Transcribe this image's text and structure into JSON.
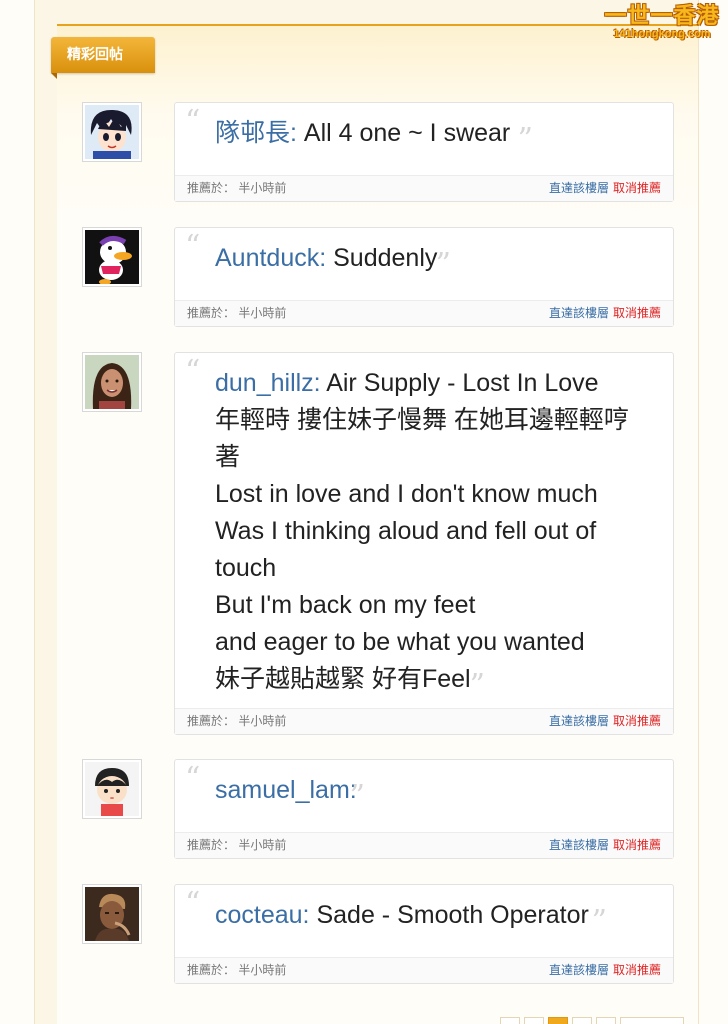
{
  "site_logo": {
    "main": "一世一香港",
    "sub": "141hongkong.com"
  },
  "section_title": "精彩回帖",
  "footer_labels": {
    "recommended": "推薦於：",
    "jump": "直達該樓層",
    "cancel": "取消推薦"
  },
  "posts": [
    {
      "author": "隊邨長:",
      "lines": [
        " All 4 one ~ I swear"
      ],
      "time": "半小時前",
      "avatar": "anime-boy"
    },
    {
      "author": "Auntduck:",
      "lines": [
        " Suddenly"
      ],
      "time": "半小時前",
      "avatar": "duck"
    },
    {
      "author": "dun_hillz:",
      "lines": [
        " Air Supply - Lost In Love",
        "年輕時 摟住妹子慢舞 在她耳邊輕輕哼",
        "著",
        "Lost in love and I don't know much",
        "Was I thinking aloud and fell out of",
        "touch",
        "But I'm back on my feet",
        "and eager to be what you wanted",
        "妹子越貼越緊 好有Feel"
      ],
      "time": "半小時前",
      "avatar": "woman"
    },
    {
      "author": "samuel_lam:",
      "lines": [
        ""
      ],
      "time": "半小時前",
      "avatar": "cartoon-kid"
    },
    {
      "author": "cocteau:",
      "lines": [
        " Sade - Smooth Operator"
      ],
      "time": "半小時前",
      "avatar": "man-photo"
    }
  ]
}
